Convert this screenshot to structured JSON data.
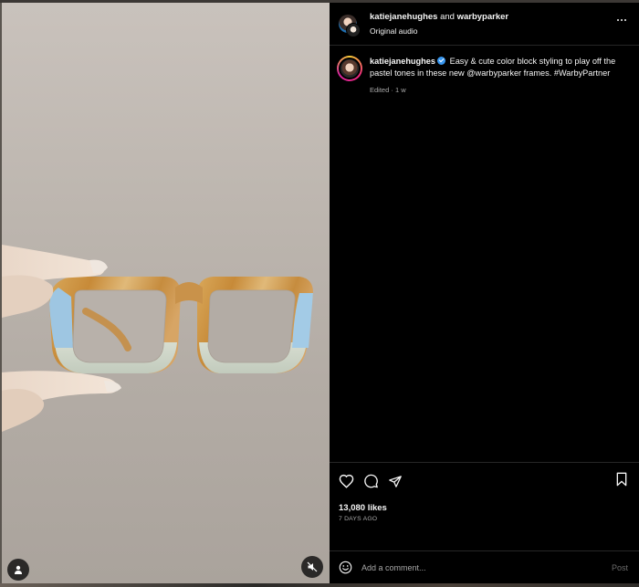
{
  "post": {
    "header": {
      "user1": "katiejanehughes",
      "and_text": "and",
      "user2": "warbyparker",
      "audio": "Original audio"
    },
    "caption": {
      "username": "katiejanehughes",
      "text": "Easy & cute color block styling to play off the pastel tones in these new @warbyparker frames. #WarbyPartner",
      "edited": "Edited",
      "time": "1 w"
    },
    "likes": "13,080 likes",
    "date": "7 DAYS AGO",
    "comment": {
      "placeholder": "Add a comment...",
      "post_label": "Post"
    }
  },
  "icons": {
    "header_more": "more-horizontal-icon",
    "like": "heart-icon",
    "comment": "comment-icon",
    "share": "share-icon",
    "save": "bookmark-icon",
    "emoji": "emoji-icon",
    "tags": "user-tag-icon",
    "mute": "muted-speaker-icon"
  },
  "colors": {
    "panel_bg": "#000000",
    "text": "#f5f5f5",
    "muted": "#a8a8a8",
    "verified": "#3897f0",
    "divider": "#262626"
  }
}
